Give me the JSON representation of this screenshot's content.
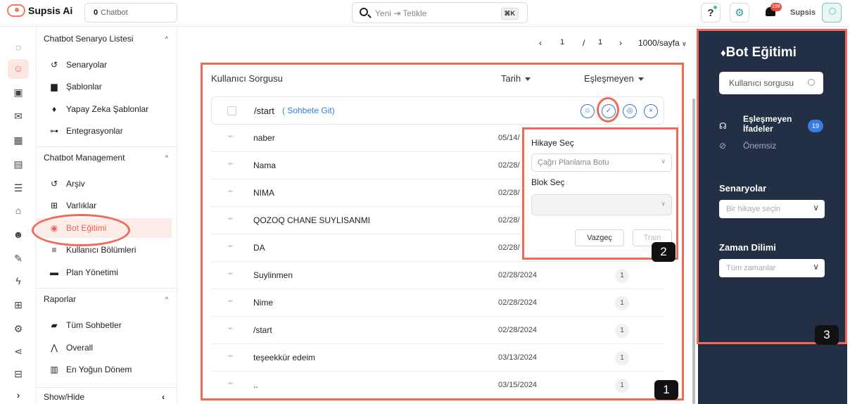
{
  "topbar": {
    "app_name": "Supsis Ai",
    "chatbot_count": "0",
    "chatbot_label": "Chatbot",
    "search_placeholder": "Yeni ⇥ Tetikle",
    "search_shortcut": "⌘K",
    "help_label": "?",
    "notification_count": "198",
    "user_name": "Supsis"
  },
  "sidebar": {
    "sections": [
      {
        "title": "Chatbot Senaryo Listesi",
        "items": [
          {
            "label": "Senaryolar",
            "icon": "history-icon"
          },
          {
            "label": "Şablonlar",
            "icon": "template-icon"
          },
          {
            "label": "Yapay Zeka Şablonlar",
            "icon": "ai-bulb-icon"
          },
          {
            "label": "Entegrasyonlar",
            "icon": "key-icon"
          }
        ]
      },
      {
        "title": "Chatbot Management",
        "items": [
          {
            "label": "Arşiv",
            "icon": "history-icon"
          },
          {
            "label": "Varlıklar",
            "icon": "grid-icon"
          },
          {
            "label": "Bot Eğitimi",
            "icon": "training-icon",
            "active": true
          },
          {
            "label": "Kullanıcı Bölümleri",
            "icon": "list-icon"
          },
          {
            "label": "Plan Yönetimi",
            "icon": "plan-icon"
          }
        ]
      },
      {
        "title": "Raporlar",
        "items": [
          {
            "label": "Tüm Sohbetler",
            "icon": "chat-icon"
          },
          {
            "label": "Overall",
            "icon": "chart-icon"
          },
          {
            "label": "En Yoğun Dönem",
            "icon": "bar-chart-icon"
          }
        ]
      }
    ],
    "footer_label": "Show/Hide"
  },
  "pager": {
    "current": "1",
    "separator": "/",
    "total": "1",
    "per_page": "1000/sayfa"
  },
  "table": {
    "col_query": "Kullanıcı Sorgusu",
    "col_date": "Tarih",
    "col_unmatched": "Eşleşmeyen",
    "first_query": "/start",
    "first_link": "( Sohbete Git)",
    "quote_mark": "\"\"",
    "rows": [
      {
        "query": "naber",
        "date": "05/14/",
        "count": ""
      },
      {
        "query": "Nama",
        "date": "02/28/",
        "count": ""
      },
      {
        "query": "NIMA",
        "date": "02/28/",
        "count": ""
      },
      {
        "query": "QOZOQ CHANE SUYLISANMI",
        "date": "02/28/",
        "count": ""
      },
      {
        "query": "DA",
        "date": "02/28/",
        "count": ""
      },
      {
        "query": "Suylinmen",
        "date": "02/28/2024",
        "count": "1"
      },
      {
        "query": "Nime",
        "date": "02/28/2024",
        "count": "1"
      },
      {
        "query": "/start",
        "date": "02/28/2024",
        "count": "1"
      },
      {
        "query": "teşeekkür edeim",
        "date": "03/13/2024",
        "count": "1"
      },
      {
        "query": "..",
        "date": "03/15/2024",
        "count": "1"
      }
    ]
  },
  "popup": {
    "story_label": "Hikaye Seç",
    "story_value": "Çağrı Planlama Botu",
    "block_label": "Blok Seç",
    "block_value": "",
    "cancel_label": "Vazgeç",
    "train_label": "Train"
  },
  "right_panel": {
    "title": "Bot Eğitimi",
    "search_placeholder": "Kullanıcı sorgusu",
    "unmatched_label": "Eşleşmeyen İfadeler",
    "unmatched_count": "19",
    "unimportant_label": "Önemsiz",
    "scenarios_label": "Senaryolar",
    "scenarios_placeholder": "Bir hikaye seçin",
    "timezone_label": "Zaman Dilimi",
    "timezone_placeholder": "Tüm zamanlar"
  },
  "annotations": {
    "one": "1",
    "two": "2",
    "three": "3"
  },
  "colors": {
    "accent": "#ee6b58",
    "link": "#2f7fe0",
    "panel": "#232f45",
    "badge": "#3a7de0"
  }
}
